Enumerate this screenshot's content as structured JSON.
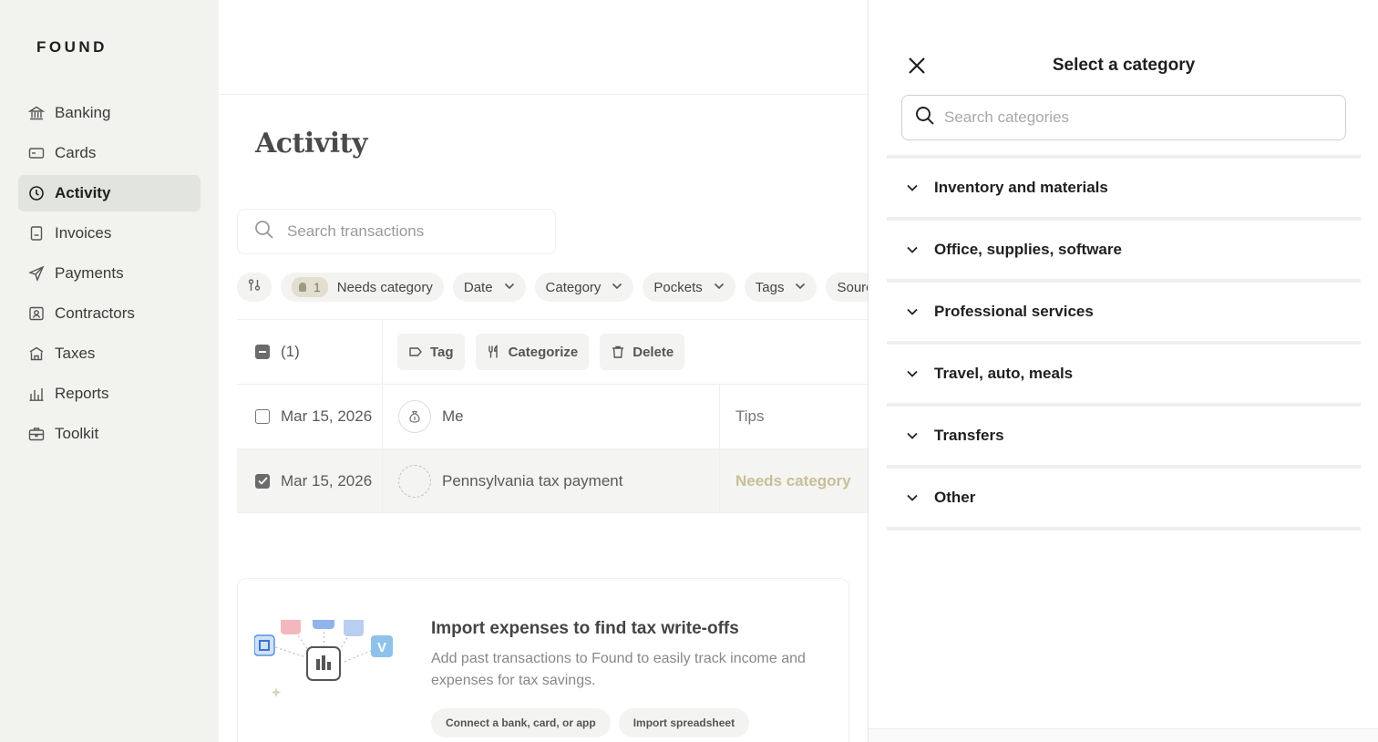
{
  "brand": "FOUND",
  "sidebar": {
    "items": [
      {
        "label": "Banking",
        "icon": "bank-icon"
      },
      {
        "label": "Cards",
        "icon": "card-icon"
      },
      {
        "label": "Activity",
        "icon": "clock-icon",
        "active": true
      },
      {
        "label": "Invoices",
        "icon": "invoice-icon"
      },
      {
        "label": "Payments",
        "icon": "send-icon"
      },
      {
        "label": "Contractors",
        "icon": "contractor-icon"
      },
      {
        "label": "Taxes",
        "icon": "taxes-icon"
      },
      {
        "label": "Reports",
        "icon": "reports-icon"
      },
      {
        "label": "Toolkit",
        "icon": "toolkit-icon"
      }
    ]
  },
  "main": {
    "title": "Activity",
    "search_placeholder": "Search transactions",
    "filters": {
      "needs_count": "1",
      "needs_label": "Needs category",
      "date": "Date",
      "category": "Category",
      "pockets": "Pockets",
      "tags": "Tags",
      "source": "Sourc"
    },
    "bulk": {
      "selected_count": "(1)",
      "tag": "Tag",
      "categorize": "Categorize",
      "delete": "Delete"
    },
    "rows": [
      {
        "date": "Mar 15, 2026",
        "description": "Me",
        "category": "Tips",
        "checked": false
      },
      {
        "date": "Mar 15, 2026",
        "description": "Pennsylvania tax payment",
        "category": "Needs category",
        "checked": true
      }
    ],
    "import": {
      "title": "Import expenses to find tax write-offs",
      "body": "Add past transactions to Found to easily track income and expenses for tax savings.",
      "connect_button": "Connect a bank, card, or app",
      "spreadsheet_button": "Import spreadsheet"
    }
  },
  "drawer": {
    "title": "Select a category",
    "search_placeholder": "Search categories",
    "categories": [
      "Inventory and materials",
      "Office, supplies, software",
      "Professional services",
      "Travel, auto, meals",
      "Transfers",
      "Other"
    ]
  },
  "colors": {
    "sidebar_bg": "#f2f2ef",
    "active_bg": "#e2e5de",
    "needs_category": "#c8bf98"
  }
}
